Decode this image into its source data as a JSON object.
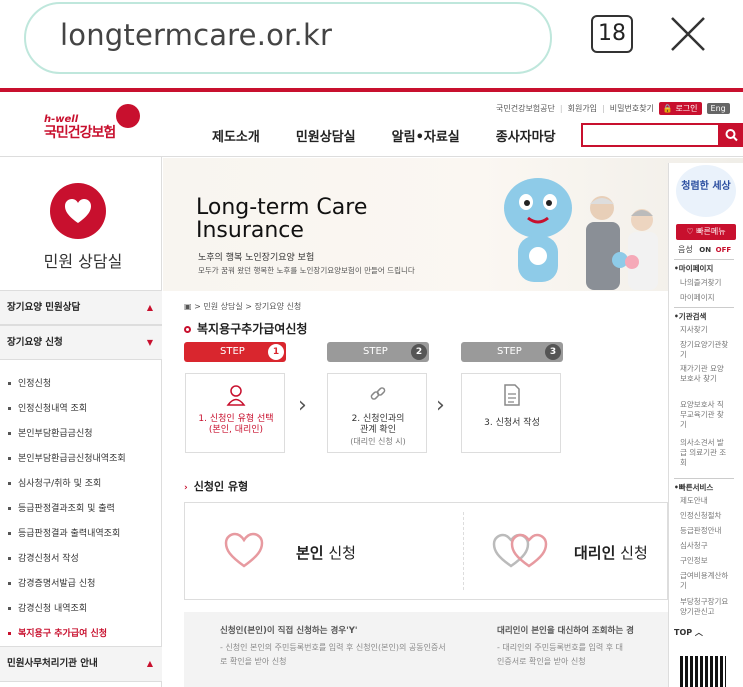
{
  "browser": {
    "url": "longtermcare.or.kr",
    "tab_count": "18"
  },
  "header": {
    "logo_brand": "h-well",
    "logo_name": "국민건강보험",
    "util_links": [
      "국민건강보험공단",
      "회원가입",
      "비밀번호찾기"
    ],
    "login_label": "로그인",
    "eng_label": "Eng",
    "gnb": [
      "제도소개",
      "민원상담실",
      "알림•자료실",
      "종사자마당"
    ]
  },
  "sidebar": {
    "title": "민원 상담실",
    "menus": [
      {
        "label": "장기요양 민원상담",
        "caret": "▲"
      },
      {
        "label": "장기요양 신청",
        "caret": "▼"
      }
    ],
    "items": [
      "인정신청",
      "인정신청내역 조회",
      "본인부담환급금신청",
      "본인부담환급금신청내역조회",
      "심사청구/취하 및 조회",
      "등급판정결과조회 및 출력",
      "등급판정결과 출력내역조회",
      "감경신청서 작성",
      "감경증명서발급 신청",
      "감경신청 내역조회",
      "복지용구 추가급여 신청"
    ],
    "bottom_menu": {
      "label": "민원사무처리기관 안내",
      "caret": "▲"
    }
  },
  "banner": {
    "title_line1": "Long-term Care",
    "title_line2": "Insurance",
    "sub1": "노후의 행복 노인장기요양 보험",
    "sub2": "모두가 꿈꿔 왔던 행복한 노후를 노인장기요양보험이 만들어 드립니다"
  },
  "quick_menu": {
    "badge": "청렴한 세상",
    "top_button": "빠른메뉴",
    "voice_label": "음성",
    "voice_on": "ON",
    "voice_off": "OFF",
    "sections": [
      {
        "head": "마이페이지",
        "items": [
          "나의즐겨찾기",
          "마이페이지"
        ]
      },
      {
        "head": "기관검색",
        "items": [
          "지사찾기",
          "장기요양기관찾기",
          "재가기관 요양보호사 찾기",
          "요양보호사 직무교육기관 찾기",
          "의사소견서 발급 의료기관 조회"
        ]
      },
      {
        "head": "빠른서비스",
        "items": [
          "제도안내",
          "인정신청절차",
          "등급판정안내",
          "심사청구",
          "구인정보",
          "급여비용계산하기",
          "부당청구장기요양기관신고"
        ]
      }
    ],
    "top_link": "TOP"
  },
  "content": {
    "breadcrumb": [
      "민원 상담실",
      "장기요양 신청"
    ],
    "page_title": "복지용구추가급여신청",
    "steps": [
      {
        "label": "STEP",
        "num": "1",
        "color": "#d9262e"
      },
      {
        "label": "STEP",
        "num": "2",
        "color": "#9a9a9a"
      },
      {
        "label": "STEP",
        "num": "3",
        "color": "#9a9a9a"
      }
    ],
    "step_boxes": [
      {
        "line1": "1. 신청인 유형 선택",
        "line2": "(본인, 대리인)"
      },
      {
        "line1": "2. 신청인과의",
        "line2": "관계 확인",
        "line3": "(대리인 신청 시)"
      },
      {
        "line1": "3. 신청서 작성"
      }
    ],
    "section_title": "신청인 유형",
    "type_self_bold": "본인",
    "type_self_rest": " 신청",
    "type_agent_bold": "대리인",
    "type_agent_rest": " 신청",
    "desc_self_title": "신청인(본인)이 직접 신청하는 경우'Y'",
    "desc_self_body": "- 신청인 본인의 주민등록번호를 입력 후 신청인(본인)의 공동인증서로 확인을 받아 신청",
    "desc_agent_title": "대리인이 본인을 대신하여 조회하는 경",
    "desc_agent_body1": "- 대리인의 주민등록번호를 입력 후 대",
    "desc_agent_body2": "인증서로 확인을 받아 신청"
  }
}
